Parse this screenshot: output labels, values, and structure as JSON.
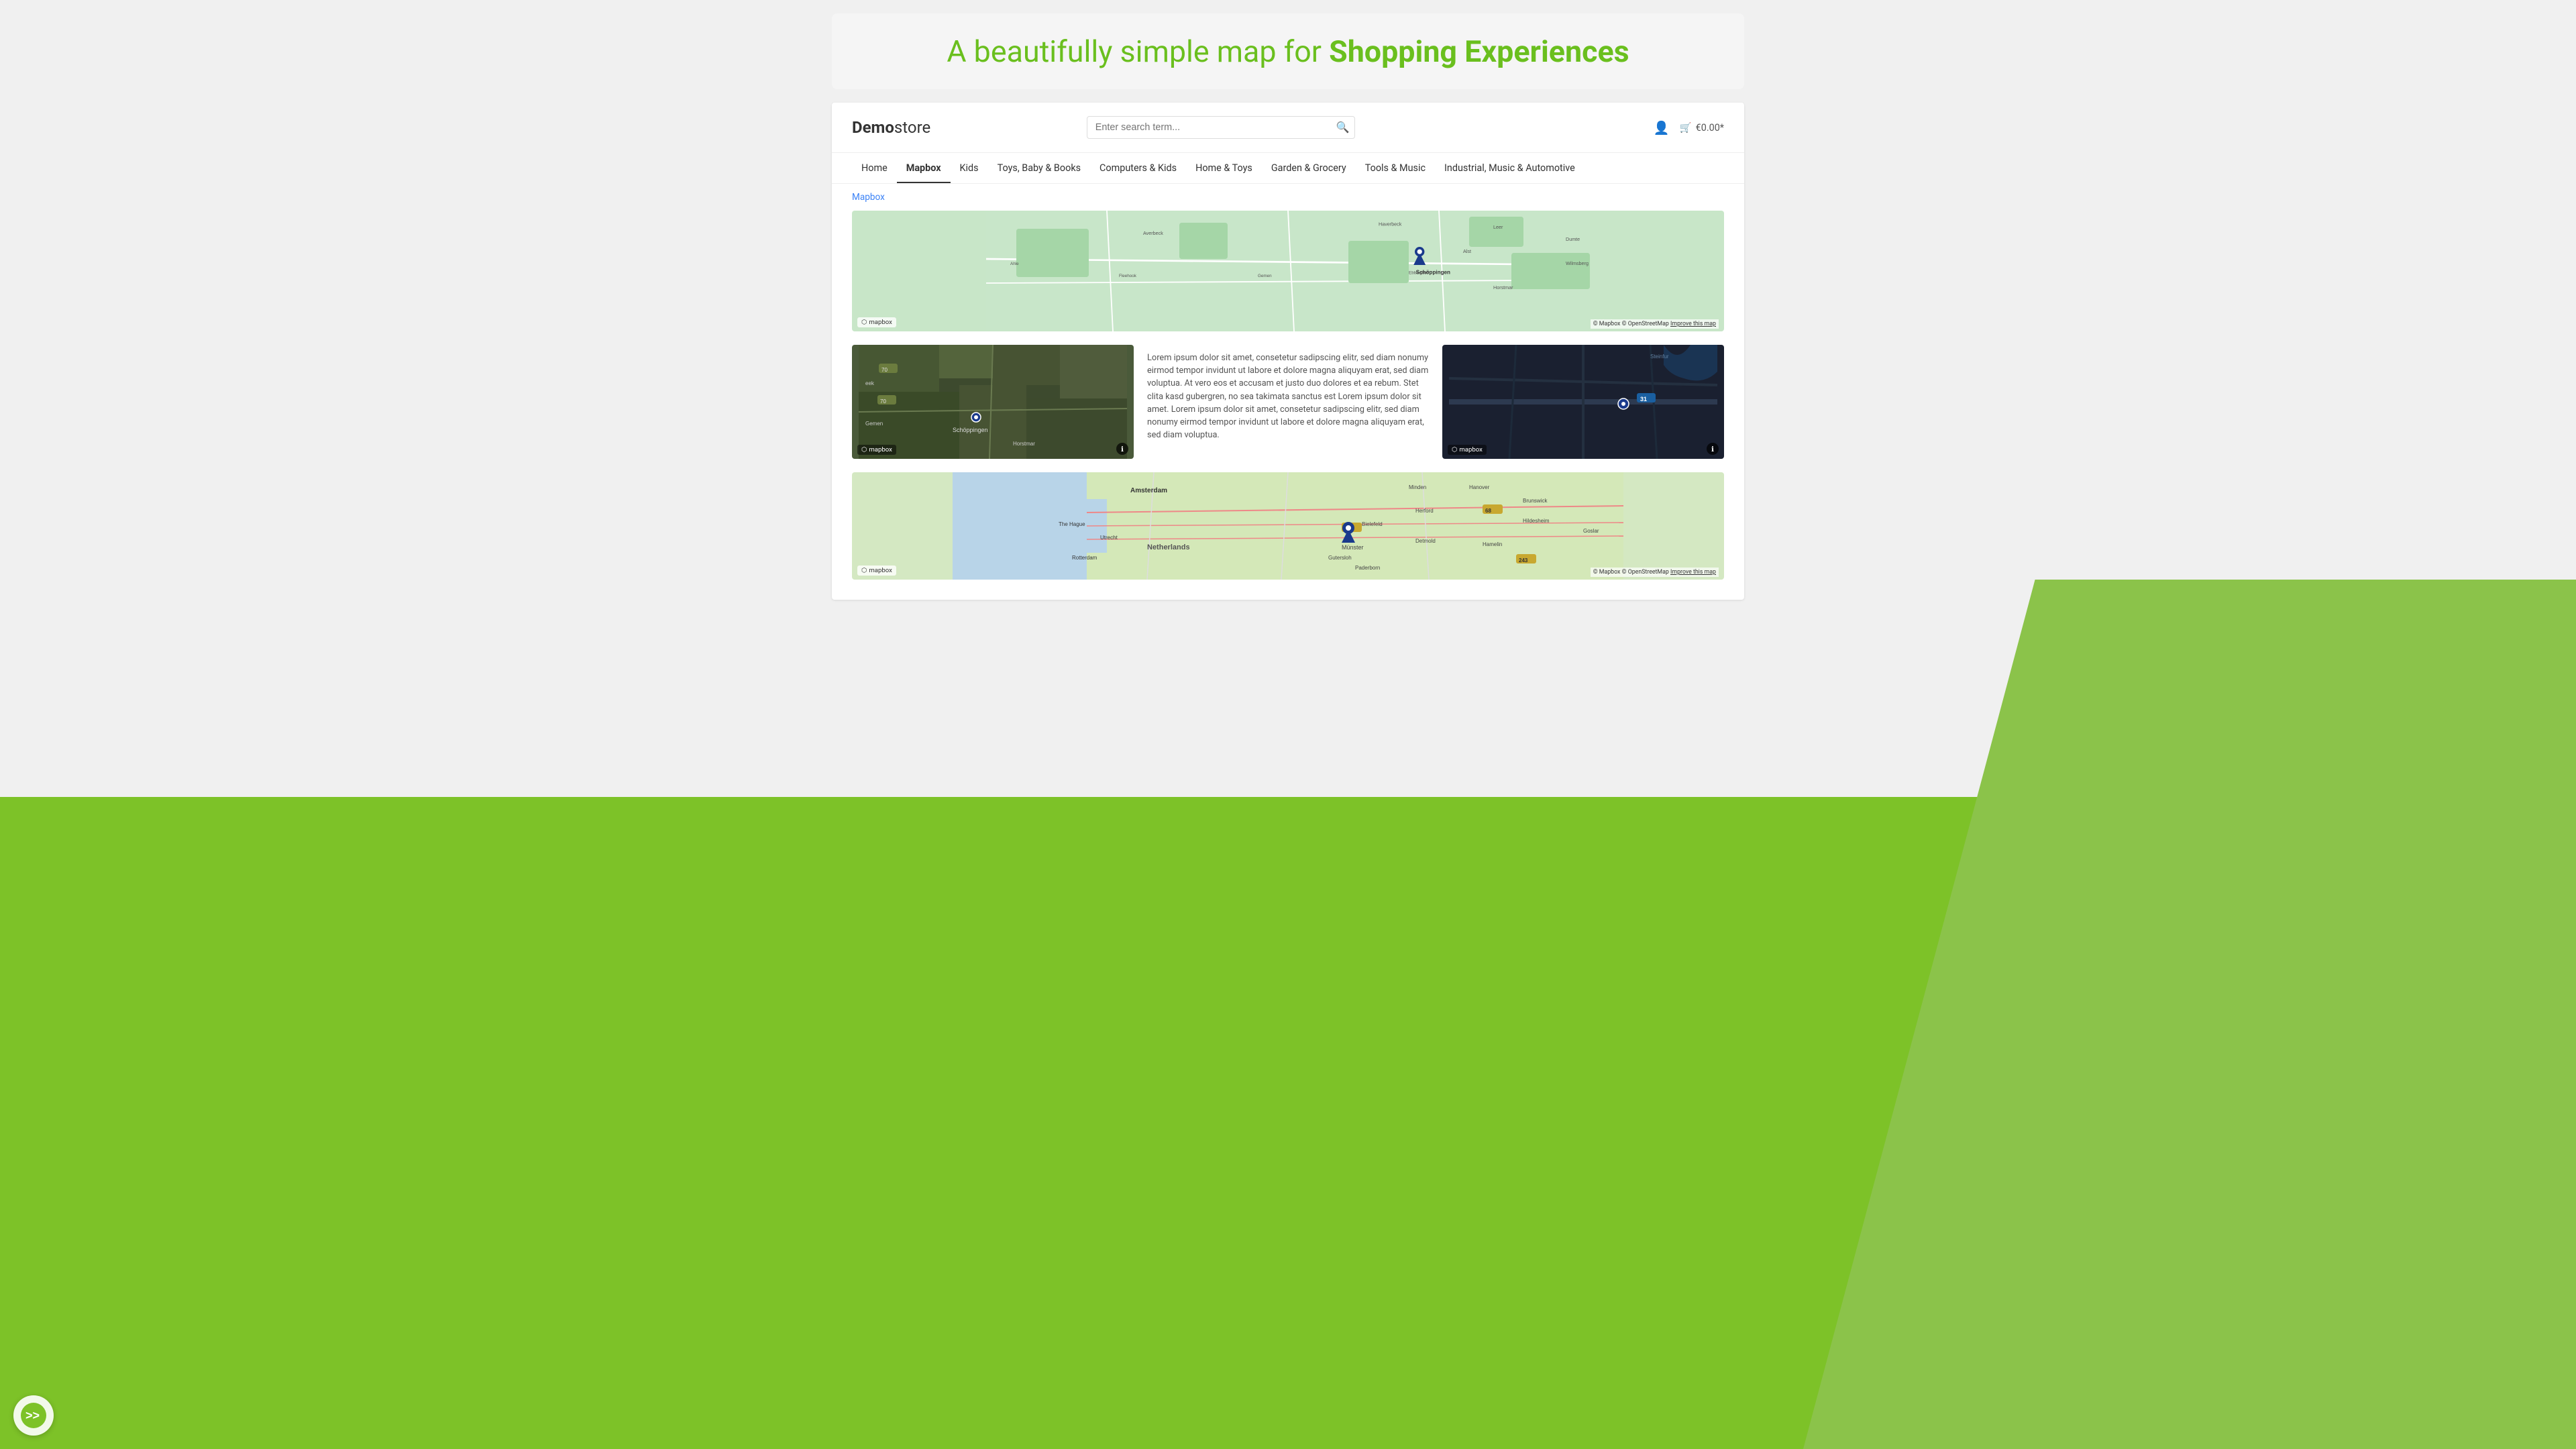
{
  "page": {
    "hero_title_part1": "A beautifully simple map for ",
    "hero_title_part2": "Shopping Experiences"
  },
  "header": {
    "logo_bold": "Demo",
    "logo_regular": "store",
    "search_placeholder": "Enter search term...",
    "cart_label": "€0.00*"
  },
  "nav": {
    "items": [
      {
        "label": "Home",
        "active": false
      },
      {
        "label": "Mapbox",
        "active": true
      },
      {
        "label": "Kids",
        "active": false
      },
      {
        "label": "Toys, Baby & Books",
        "active": false
      },
      {
        "label": "Computers & Kids",
        "active": false
      },
      {
        "label": "Home & Toys",
        "active": false
      },
      {
        "label": "Garden & Grocery",
        "active": false
      },
      {
        "label": "Tools & Music",
        "active": false
      },
      {
        "label": "Industrial, Music & Automotive",
        "active": false
      }
    ]
  },
  "breadcrumb": {
    "label": "Mapbox"
  },
  "maps": {
    "map1_location": "Schöppingen",
    "map2_location": "Schöppingen",
    "description": "Lorem ipsum dolor sit amet, consetetur sadipscing elitr, sed diam nonumy eirmod tempor invidunt ut labore et dolore magna aliquyam erat, sed diam voluptua. At vero eos et accusam et justo duo dolores et ea rebum. Stet clita kasd gubergren, no sea takimata sanctus est Lorem ipsum dolor sit amet. Lorem ipsum dolor sit amet, consetetur sadipscing elitr, sed diam nonumy eirmod tempor invidunt ut labore et dolore magna aliquyam erat, sed diam voluptua.",
    "map3_location": "Netherlands",
    "attribution1": "© Mapbox © OpenStreetMap",
    "improve_map": "Improve this map",
    "mapbox_label": "mapbox"
  },
  "bottom_logo": {
    "icon": ">>"
  }
}
